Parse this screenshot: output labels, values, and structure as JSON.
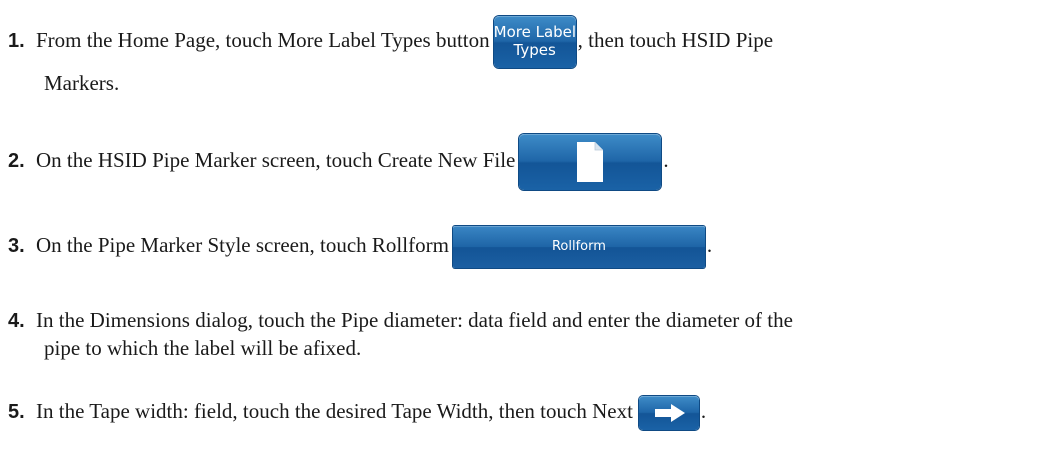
{
  "steps": [
    {
      "number": "1.",
      "text_before": "From the Home Page, touch More Label Types button",
      "button_line1": "More Label",
      "button_line2": "Types",
      "text_after": ", then touch HSID Pipe",
      "continuation": "Markers."
    },
    {
      "number": "2.",
      "text_before": "On the HSID Pipe Marker screen, touch Create New File",
      "button_icon": "document-icon",
      "text_after": "."
    },
    {
      "number": "3.",
      "text_before": "On the Pipe Marker Style screen, touch Rollform",
      "button_label": "Rollform",
      "text_after": "."
    },
    {
      "number": "4.",
      "text": "In the Dimensions dialog, touch the Pipe diameter: data field and enter the diameter of the",
      "continuation": "pipe to which the label will be afixed."
    },
    {
      "number": "5.",
      "text_before": "In the Tape width: field, touch the desired Tape Width, then touch Next",
      "button_icon": "arrow-right-icon",
      "text_after": "."
    }
  ],
  "colors": {
    "button_blue": "#1f66a8",
    "text": "#1a1a1a"
  }
}
